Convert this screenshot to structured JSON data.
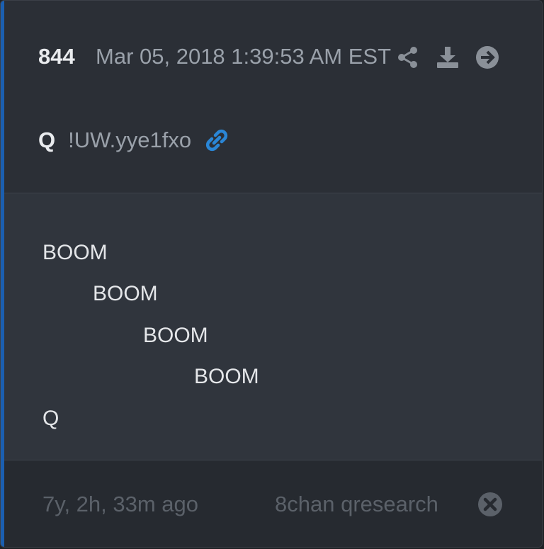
{
  "post": {
    "number": "844",
    "timestamp": "Mar 05, 2018 1:39:53 AM EST",
    "author": "Q",
    "tripcode": "!UW.yye1fxo",
    "body_lines": [
      "BOOM",
      "BOOM",
      "BOOM",
      "BOOM",
      "Q"
    ]
  },
  "footer": {
    "age": "7y, 2h, 33m ago",
    "source": "8chan qresearch"
  },
  "icons": {
    "share": "share-icon",
    "download": "download-icon",
    "navigate": "arrow-right-circle-icon",
    "link": "link-icon",
    "close": "close-circle-icon"
  },
  "colors": {
    "accent": "#1b5fb0",
    "link": "#2a86d6"
  }
}
